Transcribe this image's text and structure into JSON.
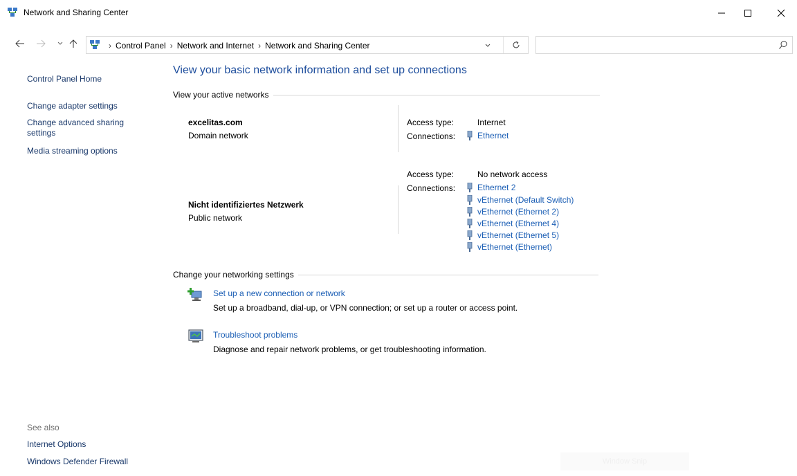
{
  "window": {
    "title": "Network and Sharing Center"
  },
  "address": {
    "crumbs": [
      "Control Panel",
      "Network and Internet",
      "Network and Sharing Center"
    ],
    "search_placeholder": ""
  },
  "sidebar": {
    "home": "Control Panel Home",
    "items": [
      "Change adapter settings",
      "Change advanced sharing settings",
      "Media streaming options"
    ],
    "see_also_label": "See also",
    "see_also": [
      "Internet Options",
      "Windows Defender Firewall"
    ]
  },
  "main": {
    "title": "View your basic network information and set up connections",
    "active_networks_heading": "View your active networks",
    "networks": [
      {
        "name": "excelitas.com",
        "category": "Domain network",
        "access_type_label": "Access type:",
        "access_type": "Internet",
        "connections_label": "Connections:",
        "connections": [
          "Ethernet"
        ]
      },
      {
        "name": "Nicht identifiziertes Netzwerk",
        "category": "Public network",
        "access_type_label": "Access type:",
        "access_type": "No network access",
        "connections_label": "Connections:",
        "connections": [
          "Ethernet 2",
          "vEthernet (Default Switch)",
          "vEthernet (Ethernet 2)",
          "vEthernet (Ethernet 4)",
          "vEthernet (Ethernet 5)",
          "vEthernet (Ethernet)"
        ]
      }
    ],
    "settings_heading": "Change your networking settings",
    "tasks": [
      {
        "link": "Set up a new connection or network",
        "desc": "Set up a broadband, dial-up, or VPN connection; or set up a router or access point.",
        "icon": "new-connection-icon"
      },
      {
        "link": "Troubleshoot problems",
        "desc": "Diagnose and repair network problems, or get troubleshooting information.",
        "icon": "troubleshoot-icon"
      }
    ]
  },
  "overlay": {
    "faint_text": "Window Snip"
  },
  "colors": {
    "link": "#1c5fb5",
    "title": "#1e4e9d",
    "sidebar_link": "#19386a"
  }
}
